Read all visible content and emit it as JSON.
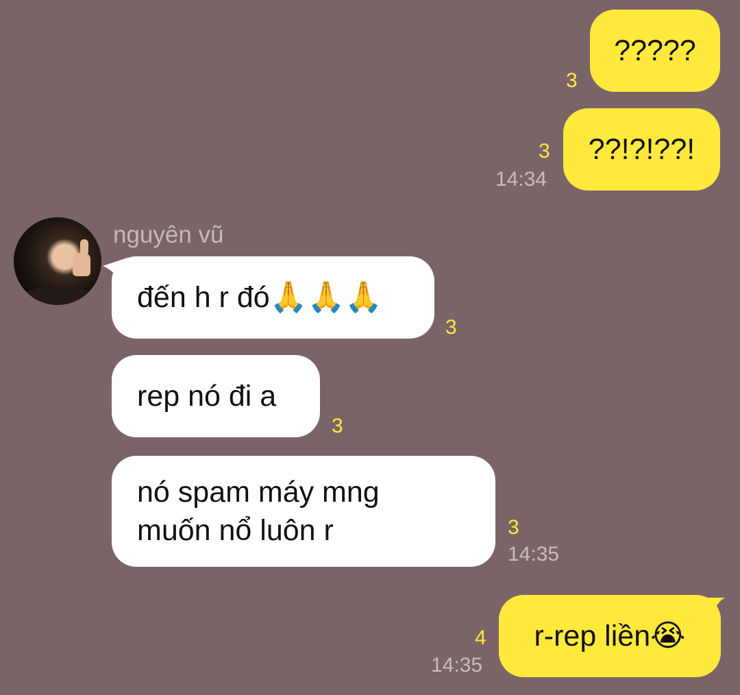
{
  "chat": {
    "sender_name": "nguyên vũ",
    "messages": [
      {
        "id": "out-1",
        "direction": "outgoing",
        "text": "?????",
        "unread": "3",
        "time": ""
      },
      {
        "id": "out-2",
        "direction": "outgoing",
        "text": "??!?!??!",
        "unread": "3",
        "time": "14:34"
      },
      {
        "id": "in-1",
        "direction": "incoming",
        "text": "đến h r đó",
        "emoji": "🙏🙏🙏",
        "unread": "3",
        "time": ""
      },
      {
        "id": "in-2",
        "direction": "incoming",
        "text": "rep nó đi a",
        "unread": "3",
        "time": ""
      },
      {
        "id": "in-3",
        "direction": "incoming",
        "line1": "nó spam máy mng",
        "line2": "muốn nổ luôn r",
        "unread": "3",
        "time": "14:35"
      },
      {
        "id": "out-3",
        "direction": "outgoing",
        "text": "r-rep liền",
        "emoji": "😭",
        "unread": "4",
        "time": "14:35"
      }
    ]
  },
  "colors": {
    "background": "#7b6468",
    "outgoing_bubble": "#ffe93c",
    "incoming_bubble": "#ffffff",
    "unread_count": "#ffe93c",
    "timestamp": "#c9bcbe"
  },
  "icons": {
    "avatar": "contact-photo-thumbs-up",
    "reaction": "praying-hands",
    "crying": "loudly-crying-face"
  }
}
